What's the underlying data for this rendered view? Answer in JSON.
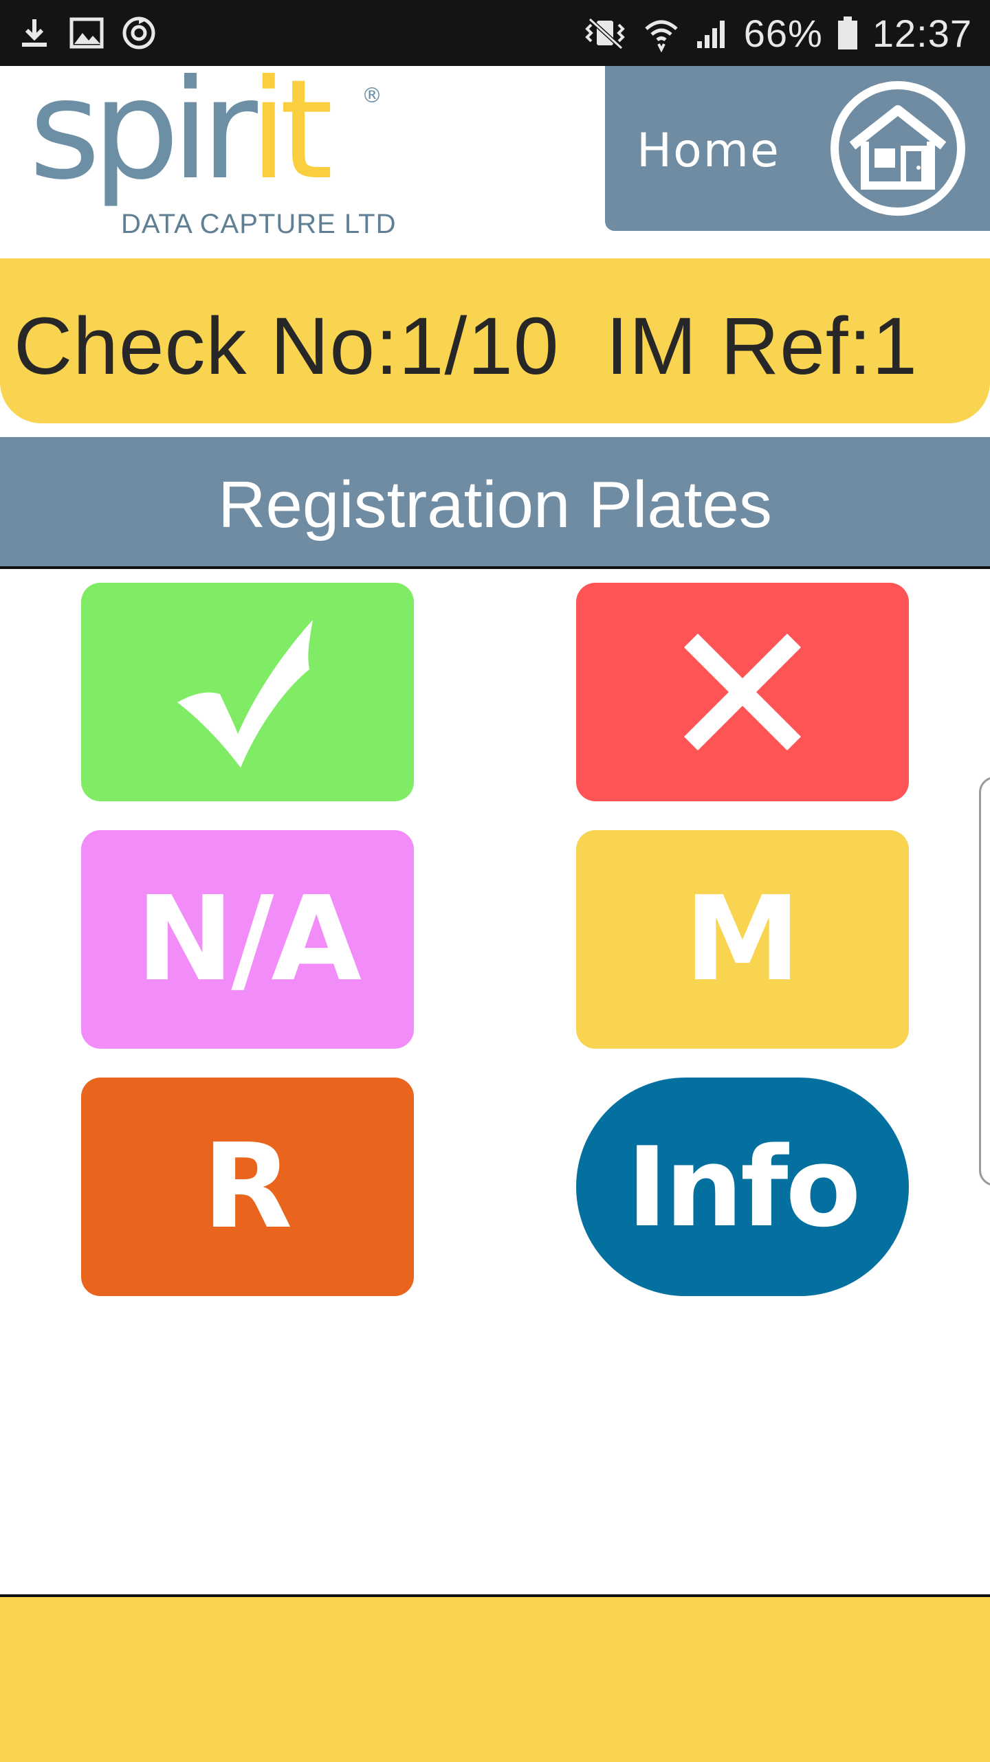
{
  "status_bar": {
    "icons": [
      "download-icon",
      "image-icon",
      "sync-icon",
      "vibrate-icon",
      "wifi-icon",
      "signal-icon",
      "battery-icon"
    ],
    "battery": "66%",
    "time": "12:37"
  },
  "header": {
    "logo": {
      "word_part1": "spir",
      "word_part2": "it",
      "registered": "®",
      "tagline": "DATA CAPTURE LTD"
    },
    "home": {
      "label": "Home",
      "icon": "house-icon"
    }
  },
  "check_banner": {
    "text": "Check No:1/10  IM Ref:1"
  },
  "section": {
    "title": "Registration Plates"
  },
  "actions": {
    "pass": {
      "icon": "checkmark-icon",
      "color": "#80ec65"
    },
    "fail": {
      "icon": "cross-icon",
      "color": "#fe5455"
    },
    "na": {
      "label": "N/A",
      "color": "#f28cf8"
    },
    "m": {
      "label": "M",
      "color": "#f9d451"
    },
    "r": {
      "label": "R",
      "color": "#e9651e"
    },
    "info": {
      "label": "Info",
      "color": "#04709f"
    }
  },
  "colors": {
    "brand_blue": "#6f8ca3",
    "brand_yellow": "#f9d451"
  }
}
